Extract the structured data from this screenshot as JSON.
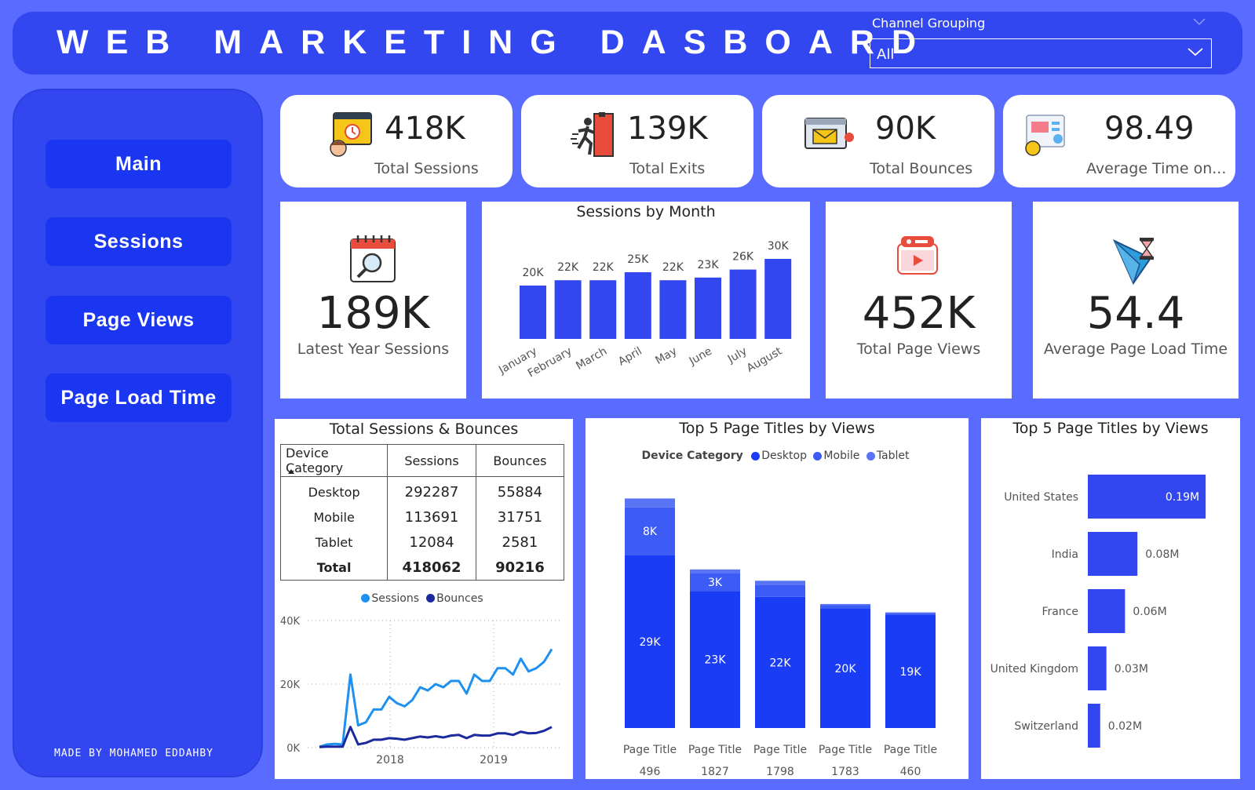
{
  "header": {
    "title": "WEB MARKETING DASBOARD",
    "channel_label": "Channel Grouping",
    "channel_value": "All"
  },
  "sidebar": {
    "items": [
      {
        "label": "Main"
      },
      {
        "label": "Sessions"
      },
      {
        "label": "Page Views"
      },
      {
        "label": "Page Load Time"
      }
    ],
    "credit": "MADE BY MOHAMED EDDAHBY"
  },
  "kpis": [
    {
      "value": "418K",
      "label": "Total Sessions"
    },
    {
      "value": "139K",
      "label": "Total Exits"
    },
    {
      "value": "90K",
      "label": "Total Bounces"
    },
    {
      "value": "98.49",
      "label": "Average Time on..."
    }
  ],
  "latest_year": {
    "value": "189K",
    "label": "Latest Year Sessions"
  },
  "page_views": {
    "value": "452K",
    "label": "Total Page Views"
  },
  "load_time": {
    "value": "54.4",
    "label": "Average Page Load Time"
  },
  "table": {
    "title": "Total Sessions & Bounces",
    "headers": [
      "Device Category",
      "Sessions",
      "Bounces"
    ],
    "rows": [
      [
        "Desktop",
        "292287",
        "55884"
      ],
      [
        "Mobile",
        "113691",
        "31751"
      ],
      [
        "Tablet",
        "12084",
        "2581"
      ]
    ],
    "total": [
      "Total",
      "418062",
      "90216"
    ]
  },
  "colors": {
    "accent": "#3347f0",
    "bar": "#3347f0",
    "background": "#5a6cff",
    "desktop": "#1a3cf5",
    "mobile": "#3d5cf5",
    "tablet": "#5a74f6",
    "sessions_line": "#1e90f0",
    "bounces_line": "#1a2a9e"
  },
  "chart_data": [
    {
      "type": "bar",
      "title": "Sessions by Month",
      "categories": [
        "January",
        "February",
        "March",
        "April",
        "May",
        "June",
        "July",
        "August"
      ],
      "values": [
        20,
        22,
        22,
        25,
        22,
        23,
        26,
        30
      ],
      "data_labels": [
        "20K",
        "22K",
        "22K",
        "25K",
        "22K",
        "23K",
        "26K",
        "30K"
      ],
      "ylim": [
        0,
        30
      ]
    },
    {
      "type": "line",
      "title": "",
      "legend": [
        "Sessions",
        "Bounces"
      ],
      "x_ticks": [
        "2018",
        "2019"
      ],
      "y_ticks": [
        "0K",
        "20K",
        "40K"
      ],
      "ylim": [
        0,
        40
      ],
      "series": [
        {
          "name": "Sessions",
          "values": [
            0.3,
            1,
            1.2,
            1,
            23,
            7,
            8,
            12,
            12,
            16,
            14,
            13,
            15,
            19,
            18,
            20,
            19,
            21,
            21,
            17,
            23,
            21,
            21,
            25,
            25,
            23,
            28,
            24,
            25,
            27,
            31
          ]
        },
        {
          "name": "Bounces",
          "values": [
            0.2,
            0.3,
            0.3,
            0.3,
            6.5,
            1,
            1.5,
            2.5,
            2.5,
            3,
            2.8,
            2.5,
            3,
            3.5,
            3.2,
            3.6,
            3.2,
            3.8,
            4,
            3,
            4,
            3.8,
            3.8,
            4.5,
            4.5,
            4,
            5,
            4.5,
            4.6,
            5.3,
            6.5
          ]
        }
      ]
    },
    {
      "type": "bar",
      "title": "Top 5 Page Titles by Views",
      "legend_title": "Device Category",
      "categories": [
        "Page Title 496",
        "Page Title 1827",
        "Page Title 1798",
        "Page Title 1783",
        "Page Title 460"
      ],
      "category_lines": [
        [
          "Page Title",
          "496"
        ],
        [
          "Page Title",
          "1827"
        ],
        [
          "Page Title",
          "1798"
        ],
        [
          "Page Title",
          "1783"
        ],
        [
          "Page Title",
          "460"
        ]
      ],
      "series": [
        {
          "name": "Desktop",
          "values": [
            29,
            23,
            22,
            20,
            19
          ],
          "labels": [
            "29K",
            "23K",
            "22K",
            "20K",
            "19K"
          ]
        },
        {
          "name": "Mobile",
          "values": [
            8,
            3,
            2,
            0.6,
            0.3
          ],
          "labels": [
            "8K",
            "3K",
            "",
            "",
            ""
          ]
        },
        {
          "name": "Tablet",
          "values": [
            1.5,
            0.6,
            0.7,
            0.2,
            0.1
          ],
          "labels": [
            "",
            "",
            "",
            "",
            ""
          ]
        }
      ],
      "ylim": [
        0,
        40
      ]
    },
    {
      "type": "bar",
      "orientation": "horizontal",
      "title": "Top 5 Page Titles by Views",
      "categories": [
        "United States",
        "India",
        "France",
        "United Kingdom",
        "Switzerland"
      ],
      "values": [
        0.19,
        0.08,
        0.06,
        0.03,
        0.02
      ],
      "data_labels": [
        "0.19M",
        "0.08M",
        "0.06M",
        "0.03M",
        "0.02M"
      ],
      "xlim": [
        0,
        0.2
      ]
    }
  ]
}
